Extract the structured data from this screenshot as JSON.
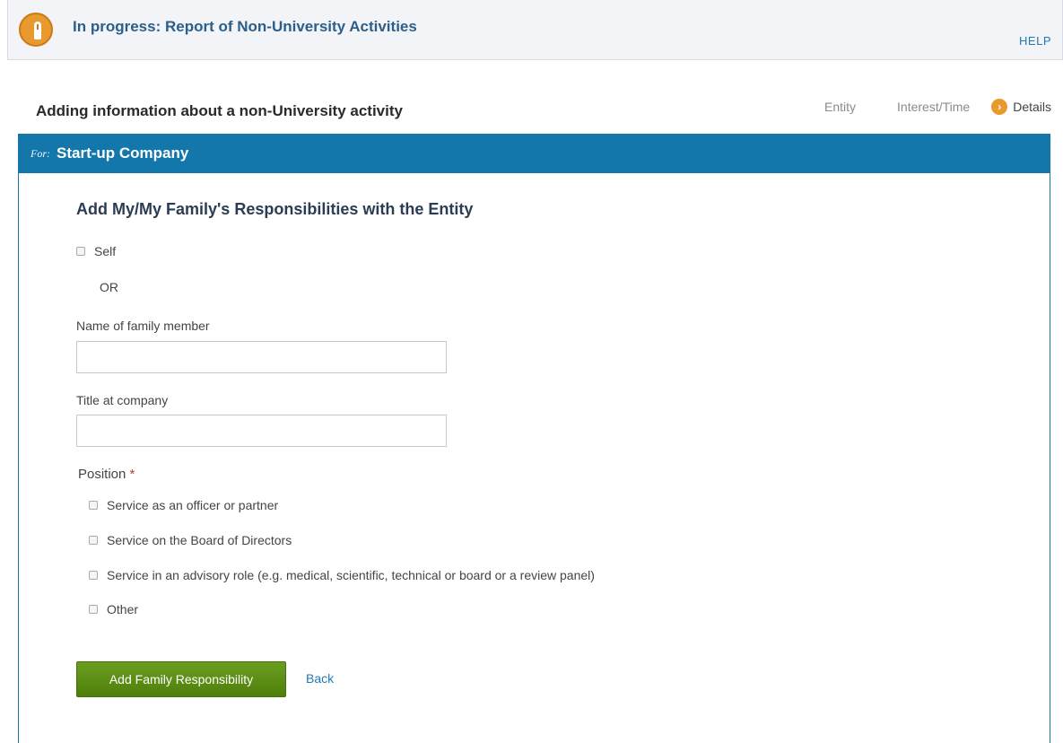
{
  "header": {
    "title": "In progress: Report of Non-University Activities",
    "help": "HELP"
  },
  "section": {
    "title": "Adding information about a non-University activity",
    "steps": [
      {
        "label": "Entity",
        "state": "done"
      },
      {
        "label": "Interest/Time",
        "state": "done"
      },
      {
        "label": "Details",
        "state": "current"
      }
    ]
  },
  "for_bar": {
    "label": "For:",
    "value": "Start-up Company"
  },
  "form": {
    "title": "Add My/My Family's Responsibilities with the Entity",
    "self_label": "Self",
    "or_label": "OR",
    "family_member_label": "Name of family member",
    "family_member_value": "",
    "title_label": "Title at company",
    "title_value": "",
    "position_label": "Position",
    "required_mark": "*",
    "positions": [
      "Service as an officer or partner",
      "Service on the Board of Directors",
      "Service in an advisory role (e.g. medical, scientific, technical or board or a review panel)",
      "Other"
    ],
    "submit_label": "Add Family Responsibility",
    "back_label": "Back"
  },
  "colors": {
    "accent": "#1477ac",
    "brand": "#e89a2e",
    "submit": "#5a8c12",
    "link": "#1f7bb2"
  },
  "icons": {
    "logo": "mouse-logo-icon",
    "current_step": "chevron-right-circle-icon"
  }
}
